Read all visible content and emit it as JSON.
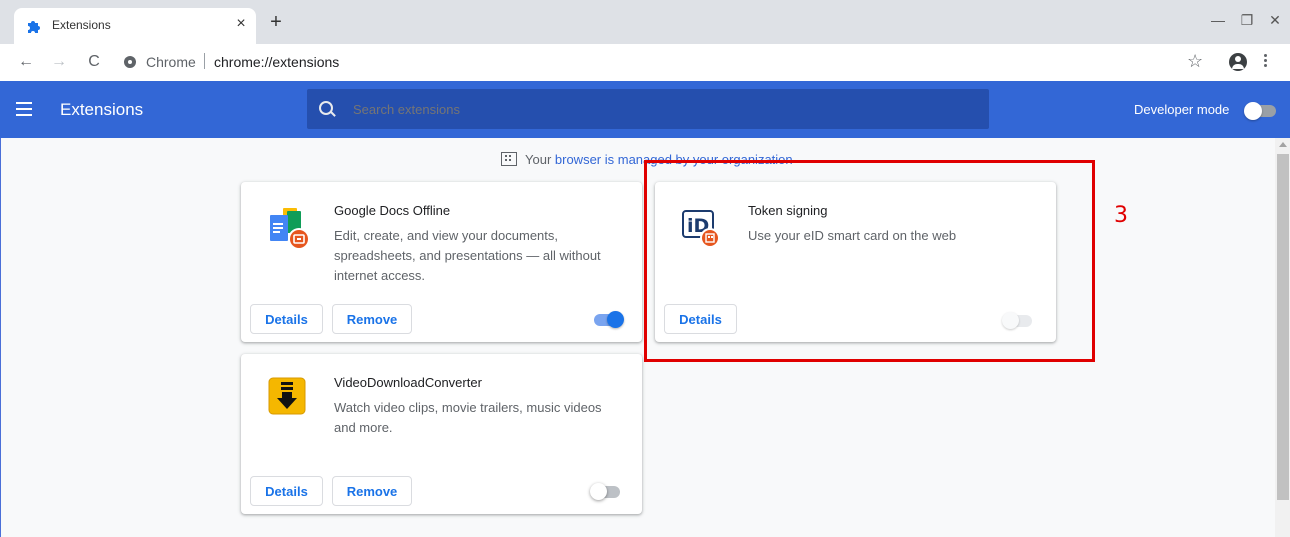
{
  "tab": {
    "title": "Extensions",
    "close": "×",
    "new_tab": "+"
  },
  "window": {
    "minimize": "—",
    "restore": "❐",
    "close": "✕"
  },
  "toolbar": {
    "back": "←",
    "forward": "→",
    "reload": "C",
    "omnibox_chip": "Chrome",
    "url": "chrome://extensions",
    "star": "☆"
  },
  "header": {
    "title": "Extensions",
    "search_placeholder": "Search extensions",
    "developer_mode_label": "Developer mode",
    "developer_mode_on": false
  },
  "managed_notice": {
    "prefix": "Your ",
    "link": "browser is managed by your organization"
  },
  "extensions": [
    {
      "name": "Google Docs Offline",
      "description": "Edit, create, and view your documents, spreadsheets, and presentations — all without internet access.",
      "details_label": "Details",
      "remove_label": "Remove",
      "enabled": true,
      "icon": "google-docs-offline-icon"
    },
    {
      "name": "Token signing",
      "description": "Use your eID smart card on the web",
      "details_label": "Details",
      "enabled": false,
      "icon": "eid-icon",
      "icon_text": "iD"
    },
    {
      "name": "VideoDownloadConverter",
      "description": "Watch video clips, movie trailers, music videos and more.",
      "details_label": "Details",
      "remove_label": "Remove",
      "enabled": false,
      "icon": "download-arrow-icon"
    }
  ],
  "annotation": {
    "label": "3",
    "color": "#e00000"
  },
  "colors": {
    "header_bg": "#3367d6",
    "search_bg": "#254fae",
    "accent": "#1a73e8"
  }
}
